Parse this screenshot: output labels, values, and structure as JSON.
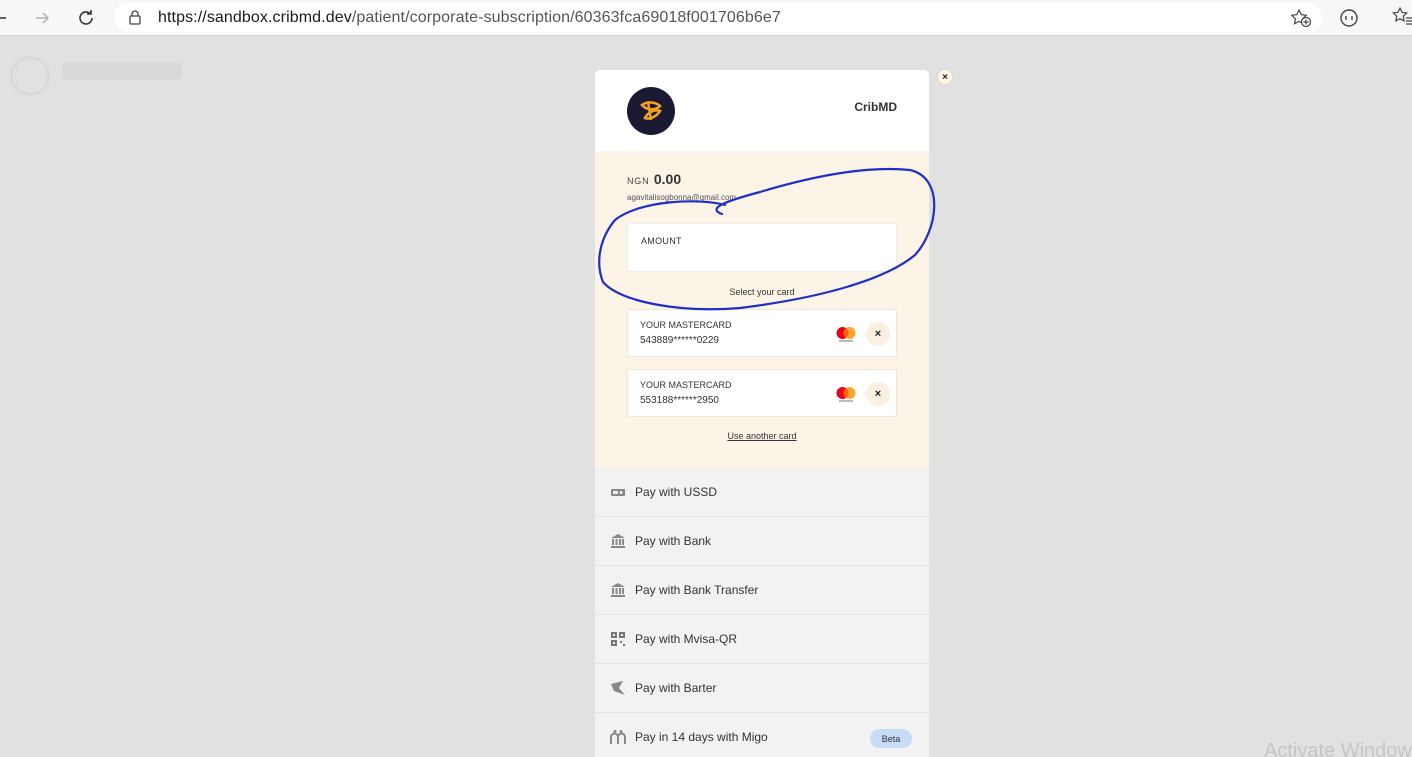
{
  "browser": {
    "url_host": "https://sandbox.cribmd.dev",
    "url_path": "/patient/corporate-subscription/60363fca69018f001706b6e7"
  },
  "background": {
    "watermark": "Activate Window"
  },
  "modal": {
    "merchant_name": "CribMD",
    "currency": "NGN",
    "amount": "0.00",
    "email": "agavitalisogbonna@gmail.com",
    "amount_label": "AMOUNT",
    "select_card_label": "Select your card",
    "saved_cards": [
      {
        "name": "YOUR MASTERCARD",
        "number": "543889******0229"
      },
      {
        "name": "YOUR MASTERCARD",
        "number": "553188******2950"
      }
    ],
    "use_another_card": "Use another card",
    "pay_options": [
      {
        "label": "Pay with USSD",
        "icon": "ussd-icon"
      },
      {
        "label": "Pay with Bank",
        "icon": "bank-icon"
      },
      {
        "label": "Pay with Bank Transfer",
        "icon": "bank-icon"
      },
      {
        "label": "Pay with Mvisa-QR",
        "icon": "qr-icon"
      },
      {
        "label": "Pay with Barter",
        "icon": "barter-icon"
      },
      {
        "label": "Pay in 14 days with Migo",
        "icon": "migo-icon",
        "badge": "Beta"
      }
    ],
    "close_symbol": "×"
  },
  "colors": {
    "card_area_bg": "#fdf4e8",
    "annotation_ink": "#1f2fc8",
    "beta_badge": "#c7dcf7"
  }
}
